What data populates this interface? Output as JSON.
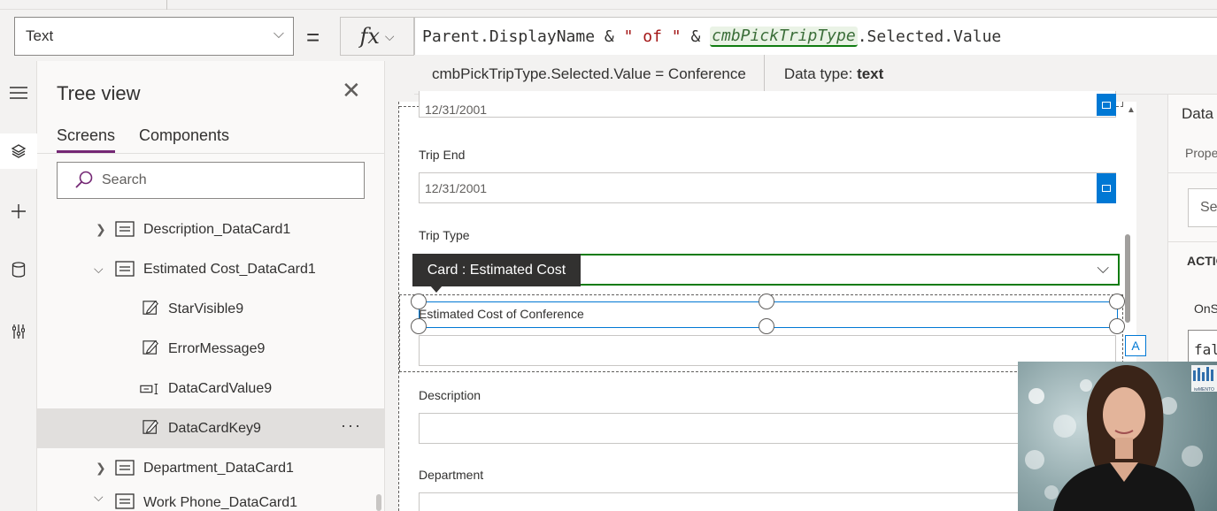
{
  "formula_bar": {
    "property": "Text",
    "equals": "=",
    "fx": "fx",
    "tokens": {
      "parent": "Parent.DisplayName",
      "amp1": " & ",
      "str": "\" of \"",
      "amp2": " & ",
      "control": "cmbPickTripType",
      "rest": ".Selected.Value"
    },
    "result": "cmbPickTripType.Selected.Value  =  Conference",
    "data_type_label": "Data type:",
    "data_type_value": "text"
  },
  "tree": {
    "title": "Tree view",
    "tabs": [
      "Screens",
      "Components"
    ],
    "search_placeholder": "Search",
    "nodes": [
      {
        "label": "Description_DataCard1"
      },
      {
        "label": "Estimated Cost_DataCard1"
      },
      {
        "label": "StarVisible9"
      },
      {
        "label": "ErrorMessage9"
      },
      {
        "label": "DataCardValue9"
      },
      {
        "label": "DataCardKey9"
      },
      {
        "label": "Department_DataCard1"
      },
      {
        "label": "Work Phone_DataCard1"
      }
    ],
    "more": "···"
  },
  "form": {
    "top_date": "12/31/2001",
    "trip_end_label": "Trip End",
    "trip_end_value": "12/31/2001",
    "trip_type_label": "Trip Type",
    "tooltip": "Card : Estimated Cost",
    "estimated_label": "Estimated Cost of Conference",
    "description_label": "Description",
    "department_label": "Department",
    "badge": "A"
  },
  "props": {
    "title": "Data",
    "tab": "Prope",
    "search": "Se",
    "section": "ACTIO",
    "onselect": "OnS",
    "value": "fal"
  },
  "video": {
    "logo": "iwMENTO"
  },
  "colors": {
    "accent_purple": "#742774",
    "selection_blue": "#0078d4",
    "focus_green": "#107c10"
  }
}
